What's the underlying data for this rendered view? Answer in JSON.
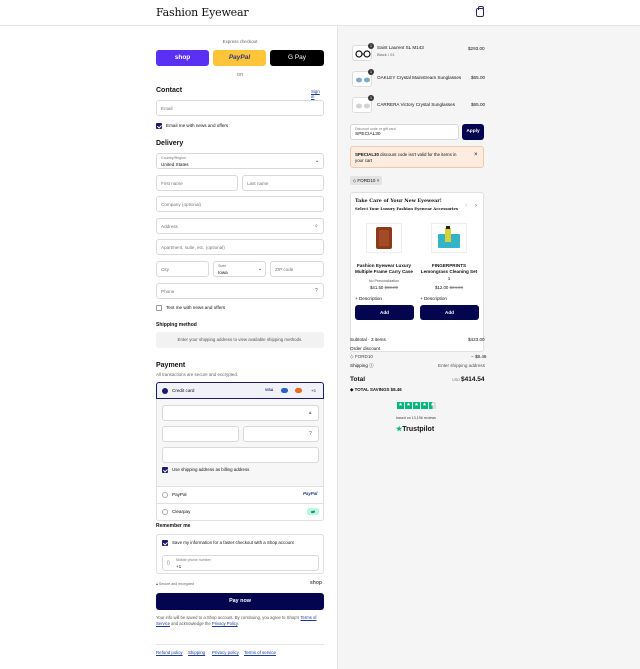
{
  "header": {
    "brand": "Fashion Eyewear"
  },
  "express": {
    "title": "Express checkout",
    "shop": "shop",
    "paypal": "PayPal",
    "gpay": "G Pay",
    "or": "OR"
  },
  "contact": {
    "title": "Contact",
    "signin": "Sign in",
    "email_placeholder": "Email",
    "newsletter": "Email me with news and offers"
  },
  "delivery": {
    "title": "Delivery",
    "country_label": "Country/Region",
    "country_value": "United States",
    "first": "First name",
    "last": "Last name",
    "company": "Company (optional)",
    "address": "Address",
    "apartment": "Apartment, suite, etc. (optional)",
    "city": "City",
    "state_label": "State",
    "state_value": "Iowa",
    "zip": "ZIP code",
    "phone": "Phone",
    "text_offers": "Text me with news and offers"
  },
  "shipping_method": {
    "title": "Shipping method",
    "note": "Enter your shipping address to view available shipping methods."
  },
  "payment": {
    "title": "Payment",
    "subtitle": "All transactions are secure and encrypted.",
    "credit_card": "Credit card",
    "cards": [
      "VISA",
      "MC",
      "MC",
      "+3"
    ],
    "billing_same": "Use shipping address as billing address",
    "paypal": "PayPal",
    "paypal_logo": "PayPal",
    "clearpay": "Clearpay"
  },
  "remember": {
    "title": "Remember me",
    "save_info": "Save my information for a faster checkout with a Shop account",
    "mobile_label": "Mobile phone number",
    "mobile_value": "+1",
    "secure": "Secure and encrypted",
    "shop": "shop"
  },
  "pay": {
    "label": "Pay now",
    "legal_1": "Your info will be saved to a Shop account. By continuing, you agree to Shop's",
    "tos": "Terms of Service",
    "legal_2": "and acknowledge the",
    "privacy": "Privacy Policy",
    "period": "."
  },
  "footer": {
    "links": [
      "Refund policy",
      "Shipping",
      "Privacy policy",
      "Terms of service"
    ]
  },
  "cart": {
    "items": [
      {
        "qty": "1",
        "name": "Saint Laurent SL M143",
        "variant": "Black / 01",
        "price": "$293.00"
      },
      {
        "qty": "1",
        "name": "OAKLEY Crystal Mainstream Sunglasses",
        "variant": "",
        "price": "$65.00"
      },
      {
        "qty": "1",
        "name": "CARRERA Victory Crystal Sunglasses",
        "variant": "",
        "price": "$65.00"
      }
    ],
    "discount_label": "Discount code or gift card",
    "discount_value": "SPECIAL30",
    "apply": "Apply",
    "warning_code": "SPECIAL30",
    "warning_text": "discount code isn't valid for the items in your cart",
    "applied_tag": "FORD10"
  },
  "upsell": {
    "title": "Take Care of Your New Eyewear!",
    "subtitle": "Select Your Luxury Fashion Eyewear Accessories",
    "products": [
      {
        "name": "Fashion Eyewear Luxury Multiple Frame Carry Case",
        "variant": "No Personalization",
        "price": "$41.50",
        "old": "$83.00",
        "desc": "Description",
        "add": "Add"
      },
      {
        "name": "FINGERPRINTS Lemongrass Cleaning Set",
        "variant": "1",
        "price": "$12.00",
        "old": "$24.00",
        "desc": "Description",
        "add": "Add"
      }
    ]
  },
  "summary": {
    "subtotal_label": "Subtotal · 3 items",
    "subtotal": "$423.00",
    "order_discount": "Order discount",
    "code": "FORD10",
    "code_amount": "− $8.46",
    "shipping_label": "Shipping",
    "shipping_value": "Enter shipping address",
    "total_label": "Total",
    "currency": "USD",
    "total": "$414.54",
    "savings_label": "TOTAL SAVINGS",
    "savings": "$8.46"
  },
  "trust": {
    "reviews": "based on 13,196 reviews",
    "brand": "Trustpilot",
    "rating": 4.5
  }
}
